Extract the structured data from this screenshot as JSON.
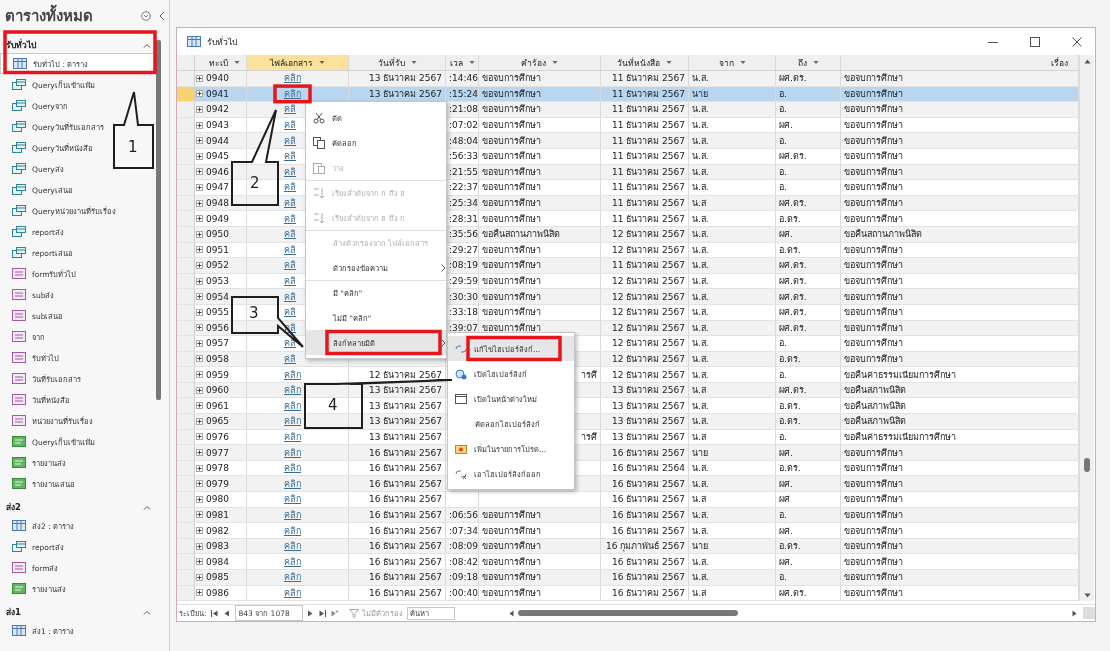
{
  "navigation_pane": {
    "title": "ตารางทั้งหมด",
    "groups": [
      {
        "label": "รับทั่วไป",
        "expanded": true,
        "items": [
          {
            "label": "รับทั่วไป : ตาราง",
            "kind": "table",
            "selected": true
          },
          {
            "label": "Queryเก็บเข้าแฟ้ม",
            "kind": "query",
            "selected": false
          },
          {
            "label": "Queryจาก",
            "kind": "query",
            "selected": false
          },
          {
            "label": "Queryวันที่รับเอกสาร",
            "kind": "query",
            "selected": false
          },
          {
            "label": "Queryวันที่หนังสือ",
            "kind": "query",
            "selected": false
          },
          {
            "label": "Queryส่ง",
            "kind": "query",
            "selected": false
          },
          {
            "label": "Queryเสนอ",
            "kind": "query",
            "selected": false
          },
          {
            "label": "Queryหน่วยงานที่รับเรื่อง",
            "kind": "query",
            "selected": false
          },
          {
            "label": "reportส่ง",
            "kind": "query",
            "selected": false
          },
          {
            "label": "reportเสนอ",
            "kind": "query",
            "selected": false
          },
          {
            "label": "formรับทั่วไป",
            "kind": "form",
            "selected": false
          },
          {
            "label": "subส่ง",
            "kind": "form",
            "selected": false
          },
          {
            "label": "subเสนอ",
            "kind": "form",
            "selected": false
          },
          {
            "label": "จาก",
            "kind": "form",
            "selected": false
          },
          {
            "label": "รับทั่วไป",
            "kind": "form",
            "selected": false
          },
          {
            "label": "วันที่รับเอกสาร",
            "kind": "form",
            "selected": false
          },
          {
            "label": "วันที่หนังสือ",
            "kind": "form",
            "selected": false
          },
          {
            "label": "หน่วยงานที่รับเรื่อง",
            "kind": "form",
            "selected": false
          },
          {
            "label": "Queryเก็บเข้าแฟ้ม",
            "kind": "report",
            "selected": false
          },
          {
            "label": "รายงานส่ง",
            "kind": "report",
            "selected": false
          },
          {
            "label": "รายงานเสนอ",
            "kind": "report",
            "selected": false
          }
        ]
      },
      {
        "label": "ส่ง2",
        "expanded": true,
        "items": [
          {
            "label": "ส่ง2 : ตาราง",
            "kind": "table",
            "selected": false
          },
          {
            "label": "reportส่ง",
            "kind": "query",
            "selected": false
          },
          {
            "label": "formส่ง",
            "kind": "form",
            "selected": false
          },
          {
            "label": "รายงานส่ง",
            "kind": "report",
            "selected": false
          }
        ]
      },
      {
        "label": "ส่ง1",
        "expanded": true,
        "items": [
          {
            "label": "ส่ง1 : ตาราง",
            "kind": "table",
            "selected": false
          }
        ]
      }
    ]
  },
  "window": {
    "title": "รับทั่วไป"
  },
  "table": {
    "columns": [
      {
        "label": "ทะเบี",
        "selected": false,
        "filter_arrow": true
      },
      {
        "label": "ไฟล์เอกสาร",
        "selected": true,
        "filter_arrow": true
      },
      {
        "label": "วันที่รับ",
        "selected": false,
        "filter_arrow": true
      },
      {
        "label": "เวล",
        "selected": false,
        "filter_arrow": true
      },
      {
        "label": "คำร้อง",
        "selected": false,
        "filter_arrow": true
      },
      {
        "label": "วันที่หนังสือ",
        "selected": false,
        "filter_arrow": true
      },
      {
        "label": "จาก",
        "selected": false,
        "filter_arrow": true
      },
      {
        "label": "ถึง",
        "selected": false,
        "filter_arrow": true
      },
      {
        "label": "เรื่อง",
        "selected": false,
        "filter_arrow": false
      }
    ],
    "rows": [
      {
        "number": "0940",
        "file": "คลิก",
        "received": "13 ธันวาคม 2567",
        "time": ":14:46",
        "request": "ขอจบการศึกษา",
        "letter_date": "11 ธันวาคม 2567",
        "from": "น.ส.",
        "to": "ผศ.ดร.",
        "subject": "ขอจบการศึกษา",
        "selected": false
      },
      {
        "number": "0941",
        "file": "คลิก",
        "received": "13 ธันวาคม 2567",
        "time": ":15:24",
        "request": "ขอจบการศึกษา",
        "letter_date": "11 ธันวาคม 2567",
        "from": "นาย",
        "to": "อ.",
        "subject": "ขอจบการศึกษา",
        "selected": true
      },
      {
        "number": "0942",
        "file": "คลิ",
        "time": ":21:08",
        "request": "ขอจบการศึกษา",
        "letter_date": "11 ธันวาคม 2567",
        "from": "น.ส.",
        "to": "อ.",
        "subject": "ขอจบการศึกษา",
        "selected": false
      },
      {
        "number": "0943",
        "file": "คลิ",
        "time": ":07:02",
        "request": "ขอจบการศึกษา",
        "letter_date": "11 ธันวาคม 2567",
        "from": "น.ส.",
        "to": "ผศ.",
        "subject": "ขอจบการศึกษา",
        "selected": false
      },
      {
        "number": "0944",
        "file": "คลิ",
        "time": ":48:04",
        "request": "ขอจบการศึกษา",
        "letter_date": "11 ธันวาคม 2567",
        "from": "น.ส.",
        "to": "อ.",
        "subject": "ขอจบการศึกษา",
        "selected": false
      },
      {
        "number": "0945",
        "file": "คลิ",
        "time": ":56:33",
        "request": "ขอจบการศึกษา",
        "letter_date": "11 ธันวาคม 2567",
        "from": "น.ส.",
        "to": "ผศ.ดร.",
        "subject": "ขอจบการศึกษา",
        "selected": false
      },
      {
        "number": "0946",
        "file": "คลิ",
        "time": ":21:55",
        "request": "ขอจบการศึกษา",
        "letter_date": "11 ธันวาคม 2567",
        "from": "น.ส.",
        "to": "อ.",
        "subject": "ขอจบการศึกษา",
        "selected": false
      },
      {
        "number": "0947",
        "file": "คลิ",
        "time": ":22:37",
        "request": "ขอจบการศึกษา",
        "letter_date": "11 ธันวาคม 2567",
        "from": "น.ส.",
        "to": "อ.",
        "subject": "ขอจบการศึกษา",
        "selected": false
      },
      {
        "number": "0948",
        "file": "คลิ",
        "time": ":25:34",
        "request": "ขอจบการศึกษา",
        "letter_date": "11 ธันวาคม 2567",
        "from": "น.ส",
        "to": "ผศ.ดร.",
        "subject": "ขอจบการศึกษา",
        "selected": false
      },
      {
        "number": "0949",
        "file": "คลิ",
        "time": ":28:31",
        "request": "ขอจบการศึกษา",
        "letter_date": "11 ธันวาคม 2567",
        "from": "น.ส.",
        "to": "อ.ดร.",
        "subject": "ขอจบการศึกษา",
        "selected": false
      },
      {
        "number": "0950",
        "file": "คลิ",
        "time": ":35:56",
        "request": "ขอคืนสถานภาพนิสิต",
        "letter_date": "12 ธันวาคม 2567",
        "from": "น.ส.",
        "to": "ผศ.",
        "subject": "ขอคืนสถานภาพนิสิต",
        "selected": false
      },
      {
        "number": "0951",
        "file": "คลิ",
        "time": ":29:27",
        "request": "ขอจบการศึกษา",
        "letter_date": "12 ธันวาคม 2567",
        "from": "น.ส.",
        "to": "อ.ดร.",
        "subject": "ขอจบการศึกษา",
        "selected": false
      },
      {
        "number": "0952",
        "file": "คลิ",
        "time": ":08:19",
        "request": "ขอจบการศึกษา",
        "letter_date": "11 ธันวาคม 2567",
        "from": "น.ส.",
        "to": "ผศ.ดร.",
        "subject": "ขอจบการศึกษา",
        "selected": false
      },
      {
        "number": "0953",
        "file": "คลิ",
        "time": ":29:59",
        "request": "ขอจบการศึกษา",
        "letter_date": "12 ธันวาคม 2567",
        "from": "น.ส.",
        "to": "ผศ.ดร.",
        "subject": "ขอจบการศึกษา",
        "selected": false
      },
      {
        "number": "0954",
        "file": "คลิ",
        "time": ":30:30",
        "request": "ขอจบการศึกษา",
        "letter_date": "12 ธันวาคม 2567",
        "from": "น.ส.",
        "to": "ผศ.ดร.",
        "subject": "ขอจบการศึกษา",
        "selected": false
      },
      {
        "number": "0955",
        "file": "คลิ",
        "time": ":33:18",
        "request": "ขอจบการศึกษา",
        "letter_date": "12 ธันวาคม 2567",
        "from": "น.ส.",
        "to": "ผศ.ดร.",
        "subject": "ขอจบการศึกษา",
        "selected": false
      },
      {
        "number": "0956",
        "file": "คลิ",
        "time": ":39:07",
        "request": "ขอจบการศึกษา",
        "letter_date": "12 ธันวาคม 2567",
        "from": "น.ส.",
        "to": "ผศ.ดร.",
        "subject": "ขอจบการศึกษา",
        "selected": false
      },
      {
        "number": "0957",
        "file": "คลิ",
        "letter_date": "12 ธันวาคม 2567",
        "from": "น.ส.",
        "to": "อ.",
        "subject": "ขอจบการศึกษา",
        "selected": false
      },
      {
        "number": "0958",
        "file": "คลิ",
        "letter_date": "12 ธันวาคม 2567",
        "from": "น.ส.",
        "to": "อ.ดร.",
        "subject": "ขอจบการศึกษา",
        "selected": false
      },
      {
        "number": "0959",
        "file": "คลิก",
        "received": "12 ธันวาคม 2567",
        "request_tail": "ารศึ",
        "letter_date": "12 ธันวาคม 2567",
        "from": "น.ส.",
        "to": "อ.",
        "subject": "ขอคืนค่าธรรมเนียมการศึกษา",
        "selected": false
      },
      {
        "number": "0960",
        "file": "คลิก",
        "received": "13 ธันวาคม 2567",
        "letter_date": "13 ธันวาคม 2567",
        "from": "น.ส",
        "to": "ผศ.ดร.",
        "subject": "ขอคืนสภาพนิสิต",
        "selected": false
      },
      {
        "number": "0961",
        "file": "คลิก",
        "received": "13 ธันวาคม 2567",
        "letter_date": "13 ธันวาคม 2567",
        "from": "น.ส.",
        "to": "อ.ดร.",
        "subject": "ขอคืนสภาพนิสิต",
        "selected": false
      },
      {
        "number": "0965",
        "file": "คลิก",
        "received": "13 ธันวาคม 2567",
        "letter_date": "13 ธันวาคม 2567",
        "from": "น.ส.",
        "to": "อ.ดร.",
        "subject": "ขอคืนสภาพนิสิต",
        "selected": false
      },
      {
        "number": "0976",
        "file": "คลิก",
        "received": "13 ธันวาคม 2567",
        "request_tail": "ารศึ",
        "letter_date": "13 ธันวาคม 2567",
        "from": "น.ส",
        "to": "อ.",
        "subject": "ขอคืนค่าธรรมเนียมการศึกษา",
        "selected": false
      },
      {
        "number": "0977",
        "file": "คลิก",
        "received": "16 ธันวาคม 2567",
        "letter_date": "16 ธันวาคม 2567",
        "from": "นาย",
        "to": "ผศ.",
        "subject": "ขอจบการศึกษา",
        "selected": false
      },
      {
        "number": "0978",
        "file": "คลิก",
        "received": "16 ธันวาคม 2567",
        "letter_date": "16 ธันวาคม 2564",
        "from": "น.ส.",
        "to": "อ.ดร.",
        "subject": "ขอจบการศึกษา",
        "selected": false
      },
      {
        "number": "0979",
        "file": "คลิก",
        "received": "16 ธันวาคม 2567",
        "letter_date": "16 ธันวาคม 2567",
        "from": "น.ส.",
        "to": "ผศ.",
        "subject": "ขอจบการศึกษา",
        "selected": false
      },
      {
        "number": "0980",
        "file": "คลิก",
        "received": "16 ธันวาคม 2567",
        "letter_date": "16 ธันวาคม 2567",
        "from": "น.ส",
        "to": "ผศ",
        "subject": "ขอจบการศึกษา",
        "selected": false
      },
      {
        "number": "0981",
        "file": "คลิก",
        "received": "16 ธันวาคม 2567",
        "time": ":06:56",
        "request": "ขอจบการศึกษา",
        "letter_date": "16 ธันวาคม 2567",
        "from": "น.ส.",
        "to": "อ.",
        "subject": "ขอจบการศึกษา",
        "selected": false
      },
      {
        "number": "0982",
        "file": "คลิก",
        "received": "16 ธันวาคม 2567",
        "time": ":07:34",
        "request": "ขอจบการศึกษา",
        "letter_date": "16 ธันวาคม 2567",
        "from": "น.ส.",
        "to": "ผศ.",
        "subject": "ขอจบการศึกษา",
        "selected": false
      },
      {
        "number": "0983",
        "file": "คลิก",
        "received": "16 ธันวาคม 2567",
        "time": ":08:09",
        "request": "ขอจบการศึกษา",
        "letter_date": "16 กุมภาพันธ์ 2567",
        "from": "นาย",
        "to": "อ.ดร.",
        "subject": "ขอจบการศึกษา",
        "selected": false
      },
      {
        "number": "0984",
        "file": "คลิก",
        "received": "16 ธันวาคม 2567",
        "time": ":08:42",
        "request": "ขอจบการศึกษา",
        "letter_date": "16 ธันวาคม 2567",
        "from": "น.ส.",
        "to": "ผศ.",
        "subject": "ขอจบการศึกษา",
        "selected": false
      },
      {
        "number": "0985",
        "file": "คลิก",
        "received": "16 ธันวาคม 2567",
        "time": ":09:18",
        "request": "ขอจบการศึกษา",
        "letter_date": "16 ธันวาคม 2567",
        "from": "น.ส.",
        "to": "อ.",
        "subject": "ขอจบการศึกษา",
        "selected": false
      },
      {
        "number": "0986",
        "file": "คลิก",
        "received": "16 ธันวาคม 2567",
        "time": ":00:40",
        "request": "ขอจบการศึกษา",
        "letter_date": "16 ธันวาคม 2567",
        "from": "น.ส",
        "to": "ผศ.ดร.",
        "subject": "ขอจบการศึกษา",
        "selected": false
      }
    ]
  },
  "record_navigation": {
    "label": "ระเบียน:",
    "position": "843 จาก 1078",
    "filter": "ไม่มีตัวกรอง",
    "search_placeholder": "ค้นหา"
  },
  "context_menu": {
    "items": [
      {
        "label": "ตัด",
        "disabled": false,
        "submenu": false,
        "separator_before": false,
        "selected": false
      },
      {
        "label": "คัดลอก",
        "disabled": false,
        "submenu": false,
        "separator_before": false,
        "selected": false
      },
      {
        "label": "วาง",
        "disabled": true,
        "submenu": false,
        "separator_before": false,
        "selected": false
      },
      {
        "label": "เรียงลำดับจาก ก ถึง ฮ",
        "disabled": true,
        "submenu": false,
        "separator_before": true,
        "selected": false
      },
      {
        "label": "เรียงลำดับจาก ฮ ถึง ก",
        "disabled": true,
        "submenu": false,
        "separator_before": false,
        "selected": false
      },
      {
        "label": "ล้างตัวกรองจาก ไฟล์เอกสาร",
        "disabled": true,
        "submenu": false,
        "separator_before": true,
        "selected": false
      },
      {
        "label": "ตัวกรองข้อความ",
        "disabled": false,
        "submenu": true,
        "separator_before": false,
        "selected": false
      },
      {
        "label": "มี \"คลิก\"",
        "disabled": false,
        "submenu": false,
        "separator_before": true,
        "selected": false
      },
      {
        "label": "ไม่มี \"คลิก\"",
        "disabled": false,
        "submenu": false,
        "separator_before": false,
        "selected": false
      },
      {
        "label": "ลิงก์หลายมิติ",
        "disabled": false,
        "submenu": true,
        "separator_before": false,
        "selected": true
      }
    ]
  },
  "hyperlink_submenu": {
    "items": [
      {
        "label": "แก้ไขไฮเปอร์ลิงก์...",
        "selected": true
      },
      {
        "label": "เปิดไฮเปอร์ลิงก์",
        "selected": false
      },
      {
        "label": "เปิดในหน้าต่างใหม่",
        "selected": false
      },
      {
        "label": "คัดลอกไฮเปอร์ลิงก์",
        "selected": false
      },
      {
        "label": "เพิ่มในรายการโปรด...",
        "selected": false
      },
      {
        "label": "เอาไฮเปอร์ลิงก์ออก",
        "selected": false
      }
    ]
  },
  "callouts": [
    {
      "label": "1"
    },
    {
      "label": "2"
    },
    {
      "label": "3"
    },
    {
      "label": "4"
    }
  ]
}
